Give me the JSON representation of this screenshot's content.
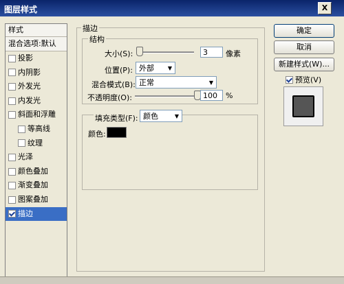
{
  "window": {
    "title": "图层样式",
    "close_glyph": "X"
  },
  "style_list": {
    "header": "样式",
    "blend_options": "混合选项:默认",
    "items": [
      {
        "label": "投影",
        "checked": false,
        "indent": false
      },
      {
        "label": "内阴影",
        "checked": false,
        "indent": false
      },
      {
        "label": "外发光",
        "checked": false,
        "indent": false
      },
      {
        "label": "内发光",
        "checked": false,
        "indent": false
      },
      {
        "label": "斜面和浮雕",
        "checked": false,
        "indent": false
      },
      {
        "label": "等高线",
        "checked": false,
        "indent": true
      },
      {
        "label": "纹理",
        "checked": false,
        "indent": true
      },
      {
        "label": "光泽",
        "checked": false,
        "indent": false
      },
      {
        "label": "颜色叠加",
        "checked": false,
        "indent": false
      },
      {
        "label": "渐变叠加",
        "checked": false,
        "indent": false
      },
      {
        "label": "图案叠加",
        "checked": false,
        "indent": false
      },
      {
        "label": "描边",
        "checked": true,
        "indent": false,
        "selected": true
      }
    ]
  },
  "stroke": {
    "section_title": "描边",
    "structure_title": "结构",
    "size_label": "大小(S):",
    "size_value": "3",
    "size_unit": "像素",
    "position_label": "位置(P):",
    "position_value": "外部",
    "blend_mode_label": "混合模式(B):",
    "blend_mode_value": "正常",
    "opacity_label": "不透明度(O):",
    "opacity_value": "100",
    "opacity_unit": "%",
    "fill_type_label": "填充类型(F):",
    "fill_type_value": "颜色",
    "color_label": "颜色:",
    "color_hex": "#000000"
  },
  "buttons": {
    "ok": "确定",
    "cancel": "取消",
    "new_style": "新建样式(W)...",
    "preview_label": "预览(V)",
    "preview_checked": true
  }
}
